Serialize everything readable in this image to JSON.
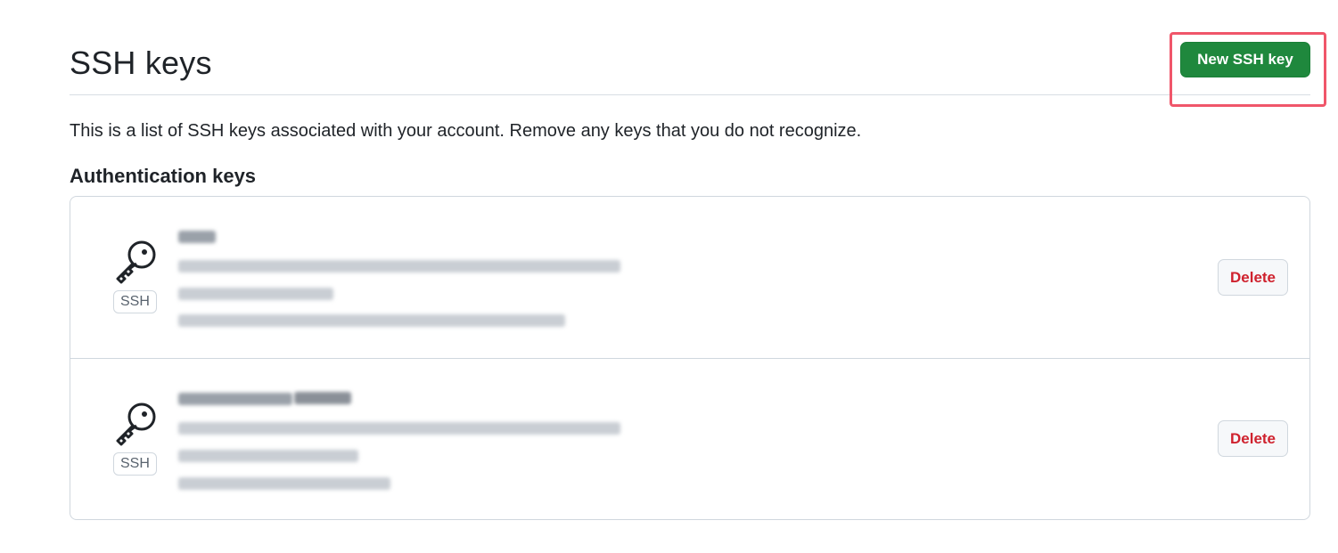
{
  "header": {
    "title": "SSH keys",
    "new_key_label": "New SSH key"
  },
  "description": "This is a list of SSH keys associated with your account. Remove any keys that you do not recognize.",
  "section_heading": "Authentication keys",
  "keys": [
    {
      "badge": "SSH",
      "delete_label": "Delete"
    },
    {
      "badge": "SSH",
      "delete_label": "Delete"
    }
  ],
  "colors": {
    "primary_button": "#1f883d",
    "delete_text": "#cf222e",
    "highlight": "#f0566a"
  },
  "icons": {
    "key": "key-icon"
  }
}
